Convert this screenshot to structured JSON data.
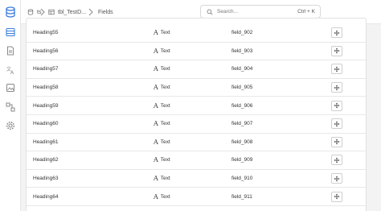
{
  "breadcrumb": {
    "db_label": "ts",
    "table_label": "tbl_TestD...",
    "page_label": "Fields"
  },
  "search": {
    "placeholder": "Search...",
    "shortcut": "Ctrl + K"
  },
  "sidebar": {
    "icons": [
      "database-icon",
      "document-icon",
      "translate-icon",
      "image-icon",
      "mapping-icon",
      "gear-icon"
    ],
    "active_color": "#3b7ddd"
  },
  "fields": [
    {
      "name": "Heading55",
      "type": "Text",
      "id": "field_902"
    },
    {
      "name": "Heading56",
      "type": "Text",
      "id": "field_903"
    },
    {
      "name": "Heading57",
      "type": "Text",
      "id": "field_904"
    },
    {
      "name": "Heading58",
      "type": "Text",
      "id": "field_905"
    },
    {
      "name": "Heading59",
      "type": "Text",
      "id": "field_906"
    },
    {
      "name": "Heading60",
      "type": "Text",
      "id": "field_907"
    },
    {
      "name": "Heading61",
      "type": "Text",
      "id": "field_908"
    },
    {
      "name": "Heading62",
      "type": "Text",
      "id": "field_909"
    },
    {
      "name": "Heading63",
      "type": "Text",
      "id": "field_910"
    },
    {
      "name": "Heading64",
      "type": "Text",
      "id": "field_911"
    }
  ]
}
